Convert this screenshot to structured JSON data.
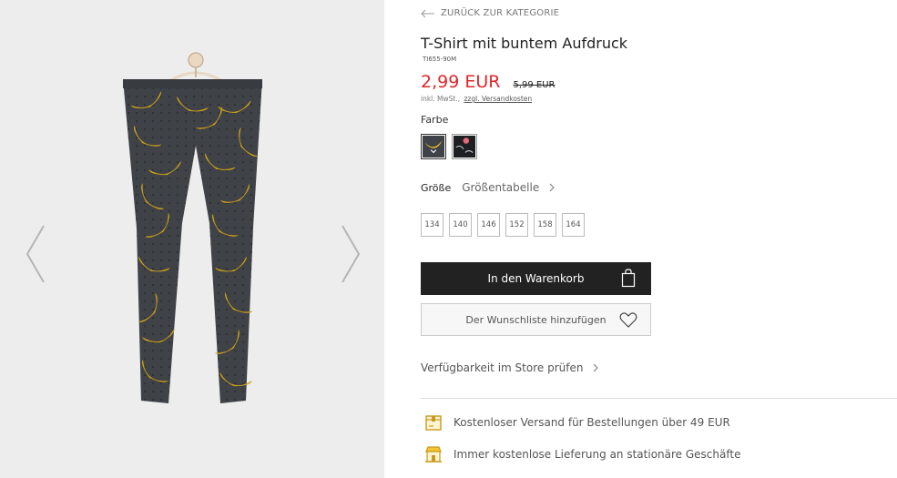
{
  "back_link": {
    "label": "ZURÜCK ZUR KATEGORIE",
    "icon": "arrow-left-icon"
  },
  "product": {
    "title": "T-Shirt mit buntem Aufdruck",
    "sku": "TI655-90M",
    "price": "2,99 EUR",
    "old_price": "5,99 EUR",
    "tax_note": "inkl. MwSt.,",
    "shipping_link": "zzgl. Versandkosten"
  },
  "color": {
    "label": "Farbe",
    "swatches": [
      {
        "name": "banana-print",
        "selected": true
      },
      {
        "name": "black-print",
        "selected": false
      }
    ]
  },
  "size": {
    "label": "Größe",
    "size_table_link": "Größentabelle",
    "options": [
      "134",
      "140",
      "146",
      "152",
      "158",
      "164"
    ]
  },
  "actions": {
    "add_to_cart": "In den Warenkorb",
    "add_to_wishlist": "Der Wunschliste hinzufügen"
  },
  "store_check": "Verfügbarkeit im Store prüfen",
  "benefits": [
    {
      "text": "Kostenloser Versand für Bestellungen über 49 EUR",
      "icon": "delivery-box-icon"
    },
    {
      "text": "Immer kostenlose Lieferung an stationäre Geschäfte",
      "icon": "store-icon"
    }
  ],
  "colors": {
    "accent": "#e0262b",
    "button_dark": "#222222",
    "icon_gold": "#c99a1e"
  }
}
